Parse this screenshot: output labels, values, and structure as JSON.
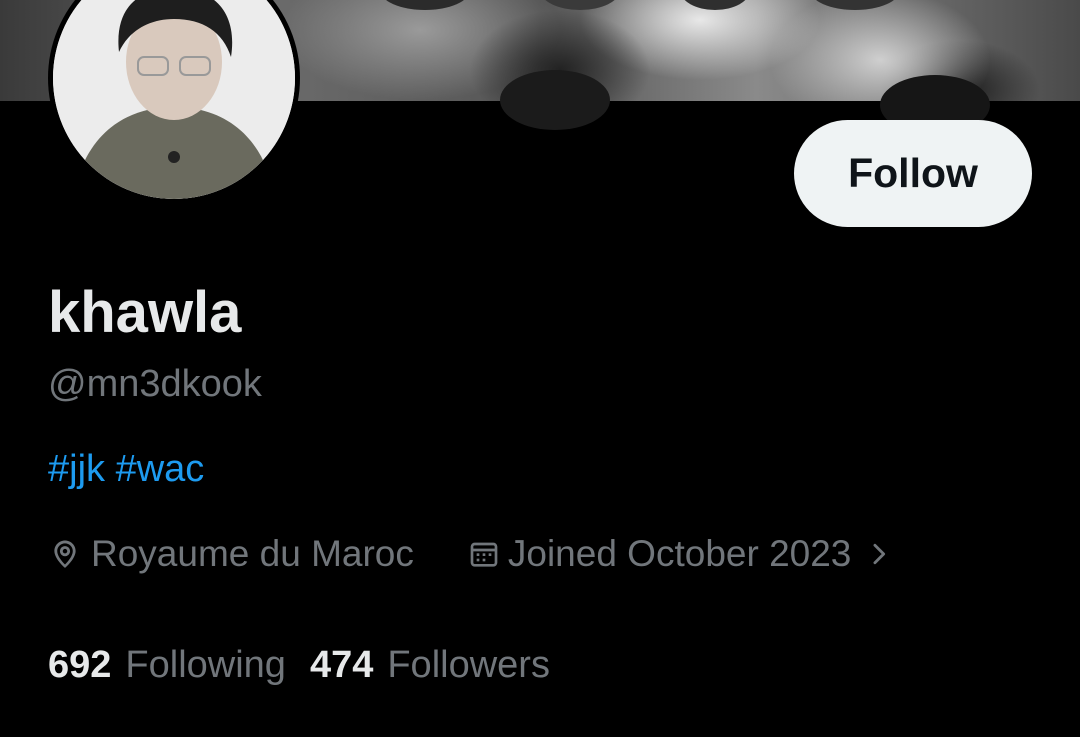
{
  "profile": {
    "display_name": "khawla",
    "handle": "@mn3dkook",
    "bio_hashtags": [
      "#jjk",
      "#wac"
    ],
    "location": "Royaume du Maroc",
    "joined": "Joined October 2023",
    "follow_label": "Follow"
  },
  "stats": {
    "following_count": "692",
    "following_label": "Following",
    "followers_count": "474",
    "followers_label": "Followers"
  },
  "icons": {
    "location": "location-pin-icon",
    "calendar": "calendar-icon",
    "chevron": "chevron-right-icon"
  },
  "colors": {
    "background": "#000000",
    "primary_text": "#e7e9ea",
    "secondary_text": "#71767b",
    "link": "#1d9bf0",
    "follow_button_bg": "#eff3f4"
  }
}
